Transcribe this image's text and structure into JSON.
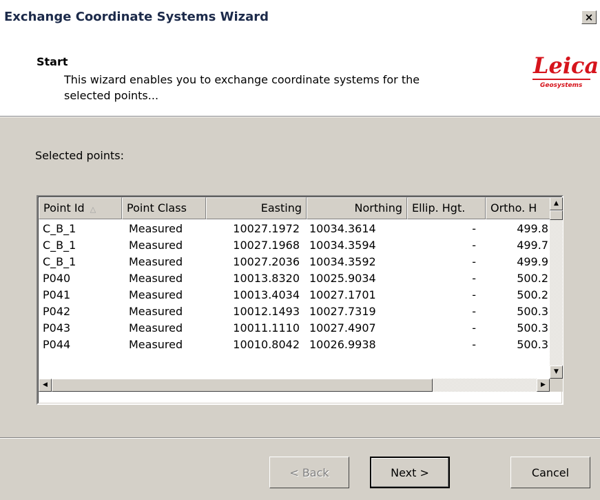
{
  "window": {
    "title": "Exchange Coordinate Systems Wizard",
    "close_glyph": "×"
  },
  "header": {
    "title": "Start",
    "description_line1": "This wizard enables you to exchange coordinate systems for the",
    "description_line2": "selected points...",
    "logo": {
      "wordmark": "Leica",
      "subtitle": "Geosystems",
      "color": "#d6141c"
    }
  },
  "selected_points_label": "Selected points:",
  "table": {
    "columns": [
      "Point Id",
      "Point Class",
      "Easting",
      "Northing",
      "Ellip. Hgt.",
      "Ortho. H"
    ],
    "sort_indicator": "△",
    "rows": [
      [
        "C_B_1",
        "Measured",
        "10027.1972",
        "10034.3614",
        "-",
        "499.8"
      ],
      [
        "C_B_1",
        "Measured",
        "10027.1968",
        "10034.3594",
        "-",
        "499.7"
      ],
      [
        "C_B_1",
        "Measured",
        "10027.2036",
        "10034.3592",
        "-",
        "499.9"
      ],
      [
        "P040",
        "Measured",
        "10013.8320",
        "10025.9034",
        "-",
        "500.2"
      ],
      [
        "P041",
        "Measured",
        "10013.4034",
        "10027.1701",
        "-",
        "500.2"
      ],
      [
        "P042",
        "Measured",
        "10012.1493",
        "10027.7319",
        "-",
        "500.3"
      ],
      [
        "P043",
        "Measured",
        "10011.1110",
        "10027.4907",
        "-",
        "500.3"
      ],
      [
        "P044",
        "Measured",
        "10010.8042",
        "10026.9938",
        "-",
        "500.3"
      ]
    ]
  },
  "buttons": {
    "back": "< Back",
    "next": "Next >",
    "cancel": "Cancel"
  }
}
